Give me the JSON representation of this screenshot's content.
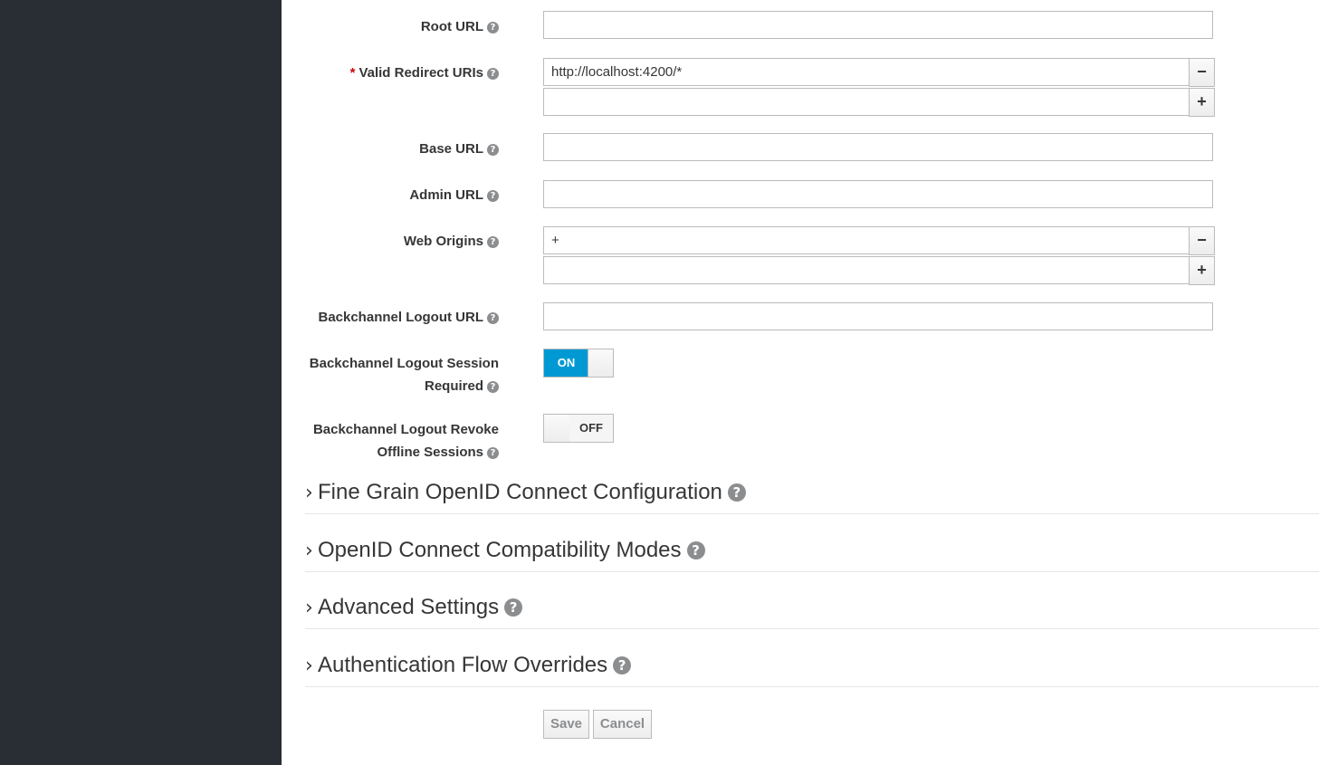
{
  "fields": {
    "root_url": {
      "label": "Root URL",
      "value": ""
    },
    "valid_redirect_uris": {
      "required_mark": "*",
      "label": "Valid Redirect URIs",
      "values": [
        "http://localhost:4200/*",
        ""
      ]
    },
    "base_url": {
      "label": "Base URL",
      "value": ""
    },
    "admin_url": {
      "label": "Admin URL",
      "value": ""
    },
    "web_origins": {
      "label": "Web Origins",
      "values": [
        "+",
        ""
      ]
    },
    "backchannel_logout_url": {
      "label": "Backchannel Logout URL",
      "value": ""
    },
    "backchannel_logout_session_required": {
      "label_line1": "Backchannel Logout Session",
      "label_line2": "Required",
      "state": "ON"
    },
    "backchannel_logout_revoke_offline": {
      "label_line1": "Backchannel Logout Revoke",
      "label_line2": "Offline Sessions",
      "state": "OFF"
    }
  },
  "icons": {
    "help": "?",
    "remove": "−",
    "add": "+",
    "chevron": "›"
  },
  "sections": [
    "Fine Grain OpenID Connect Configuration",
    "OpenID Connect Compatibility Modes",
    "Advanced Settings",
    "Authentication Flow Overrides"
  ],
  "actions": {
    "save": "Save",
    "cancel": "Cancel"
  },
  "colors": {
    "sidebar": "#292e34",
    "toggle_on": "#0099d3",
    "required": "#cc0000"
  }
}
